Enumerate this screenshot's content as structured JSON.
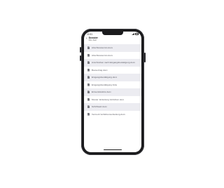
{
  "status": {
    "time": "22:31"
  },
  "header": {
    "title": "Dossier",
    "subtitle": "Düx, Axel",
    "back": "‹"
  },
  "items": [
    "Abschlusstermin.docx",
    "Abschlusstermin.docx",
    "Anschreiben nach Eingangsbestätigung.docx",
    "Bauvertrag.docx",
    "Eingangsbestätigung.docx",
    "Eingangsbestätigung Folie",
    "Einverständnis.docx",
    "Muster: Einleitung Verfahren.docx",
    "Schriftsatz.docx",
    "Vermerk Verfahrenseinleitung.docx"
  ],
  "colors": {
    "row_alt": "#ececf1",
    "phone": "#1b1b1d",
    "doc_icon": "#7a7a80"
  }
}
